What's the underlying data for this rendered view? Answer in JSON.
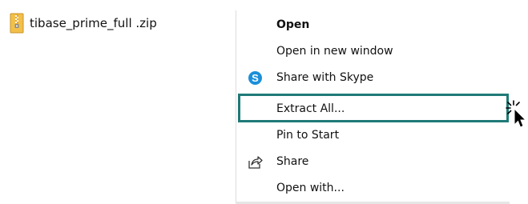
{
  "file": {
    "name": "tibase_prime_full .zip",
    "icon": "zip-folder-icon"
  },
  "context_menu": {
    "items": [
      {
        "label": "Open",
        "bold": true,
        "icon": ""
      },
      {
        "label": "Open in new window",
        "bold": false,
        "icon": ""
      },
      {
        "label": "Share with Skype",
        "bold": false,
        "icon": "skype-icon"
      },
      {
        "label": "Extract All...",
        "bold": false,
        "icon": "",
        "highlighted": true
      },
      {
        "label": "Pin to Start",
        "bold": false,
        "icon": ""
      },
      {
        "label": "Share",
        "bold": false,
        "icon": "share-icon"
      },
      {
        "label": "Open with...",
        "bold": false,
        "icon": ""
      }
    ]
  },
  "colors": {
    "highlight_border": "#1f7a77",
    "skype_blue": "#1b8fd9"
  },
  "cursor": {
    "icon": "click-cursor-icon"
  }
}
